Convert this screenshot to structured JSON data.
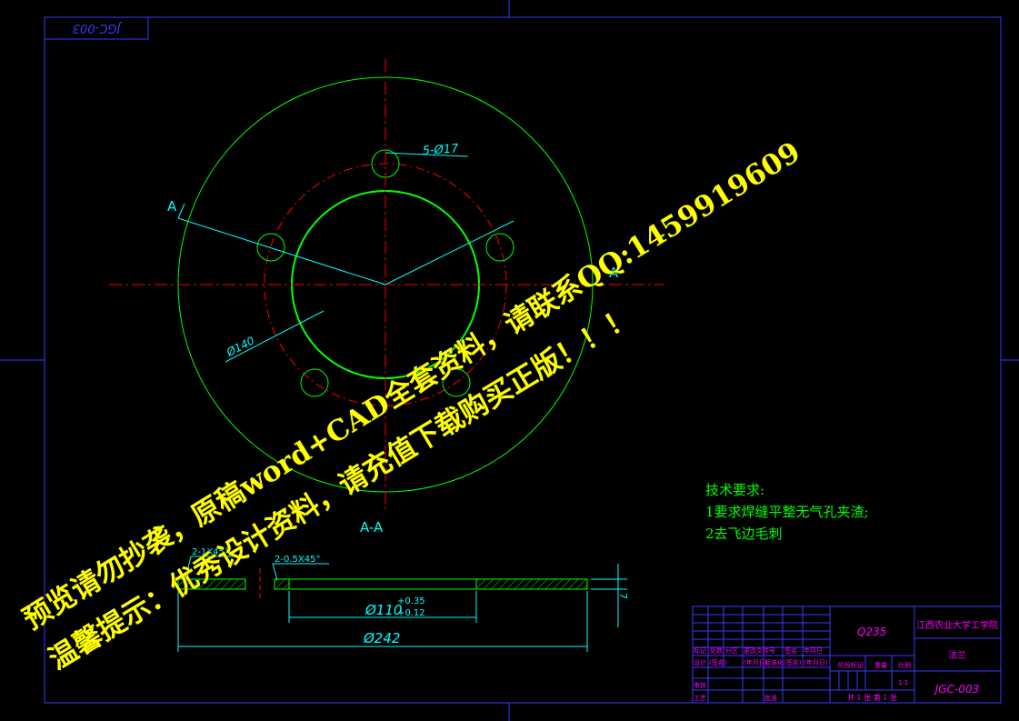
{
  "drawing_code_mirrored": "JGC-003",
  "top_view": {
    "hole_callout": "5-Ø17",
    "diameter_callout": "Ø140",
    "section_mark_left": "A",
    "section_mark_right": "A"
  },
  "section_view": {
    "title": "A-A",
    "chamfer_outer": "2-1X45°",
    "chamfer_inner": "2-0.5X45°",
    "bore_diameter": "Ø110",
    "bore_tol_upper": "+0.35",
    "bore_tol_lower": "+0.12",
    "outer_diameter": "Ø242",
    "thickness": "7"
  },
  "tech_requirements": {
    "title": "技术要求:",
    "item1": "1要求焊缝平整无气孔夹渣;",
    "item2": "2去飞边毛刺"
  },
  "title_block": {
    "material": "Q235",
    "school": "江西农业大学工学院",
    "part_name": "法兰",
    "drawing_no": "JGC-003",
    "scale": "1:1",
    "sheet_info": "共 1 张 第 1 张",
    "hdr_mark": "标记",
    "hdr_count": "处数",
    "hdr_zone": "分区",
    "hdr_change": "更改文件号",
    "hdr_sign": "签名",
    "hdr_date": "年月日",
    "hdr_design": "设计",
    "hdr_sign2": "(签名)",
    "hdr_date2": "(年月日)",
    "hdr_std": "标准化",
    "hdr_sign3": "(签名)",
    "hdr_date3": "(年月日)",
    "hdr_stage": "阶段标记",
    "hdr_weight": "重量",
    "hdr_ratio": "比例",
    "hdr_review": "审核",
    "hdr_process": "工艺",
    "hdr_approve": "批准"
  },
  "watermark": {
    "line1": "预览请勿抄袭，原稿word+CAD全套资料，请联系QQ:1459919609",
    "line2": "温馨提示：优秀设计资料，请充值下载购买正版！！！"
  },
  "colors": {
    "background": "#000000",
    "border": "#3a3aff",
    "outline": "#00ff00",
    "center_line": "#ff0000",
    "dimension": "#00ffff",
    "title_block_text": "#ff00ff",
    "tech_text": "#00ff00",
    "watermark": "#ffff00"
  }
}
